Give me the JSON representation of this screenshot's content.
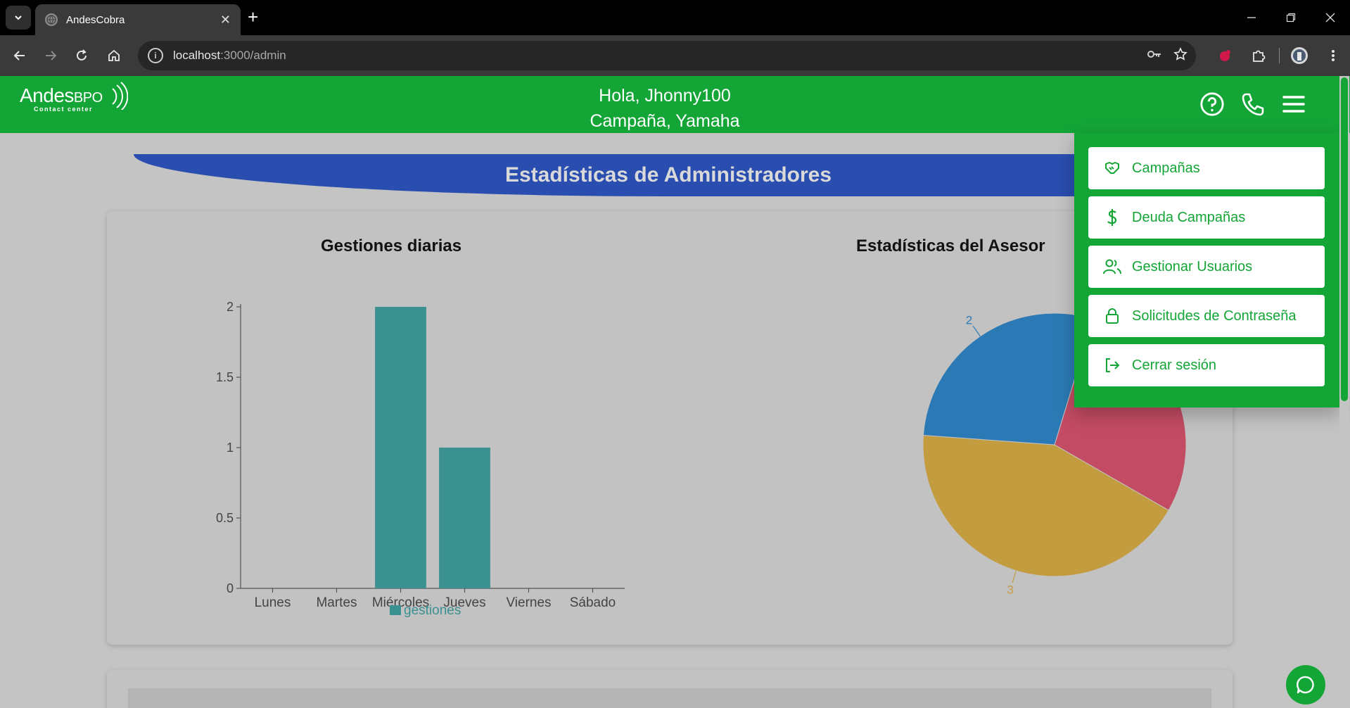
{
  "browser": {
    "tab_title": "AndesCobra",
    "new_tab": "+",
    "close_tab": "✕",
    "url_host": "localhost",
    "url_rest": ":3000/admin"
  },
  "header": {
    "logo_brand": "Andes",
    "logo_brand_suffix": "BPO",
    "logo_sub": "Contact center",
    "greeting": "Hola, Jhonny100",
    "campaign": "Campaña, Yamaha"
  },
  "banner_title": "Estadísticas de Administradores",
  "menu": {
    "items": [
      {
        "label": "Campañas",
        "icon": "handshake-icon"
      },
      {
        "label": "Deuda Campañas",
        "icon": "dollar-icon"
      },
      {
        "label": "Gestionar Usuarios",
        "icon": "users-icon"
      },
      {
        "label": "Solicitudes de Contraseña",
        "icon": "lock-icon"
      },
      {
        "label": "Cerrar sesión",
        "icon": "logout-icon"
      }
    ]
  },
  "colors": {
    "primary_green": "#14a537",
    "banner_blue": "#2a4db0",
    "bar_teal": "#3a9190",
    "pie_red": "#c34b63",
    "pie_blue": "#2b7ab5",
    "pie_gold": "#c49c40"
  },
  "chart_data": [
    {
      "type": "bar",
      "title": "Gestiones diarias",
      "categories": [
        "Lunes",
        "Martes",
        "Miércoles",
        "Jueves",
        "Viernes",
        "Sábado"
      ],
      "series": [
        {
          "name": "gestiones",
          "values": [
            0,
            0,
            2,
            1,
            0,
            0
          ]
        }
      ],
      "ylim": [
        0,
        2
      ],
      "yticks": [
        "0",
        "0.5",
        "1",
        "1.5",
        "2"
      ],
      "legend": "bottom"
    },
    {
      "type": "pie",
      "title": "Estadísticas del Asesor",
      "slices": [
        {
          "label": "2",
          "value": 2
        },
        {
          "label": "3",
          "value": 3
        },
        {
          "label": "2",
          "value": 2
        }
      ]
    }
  ]
}
